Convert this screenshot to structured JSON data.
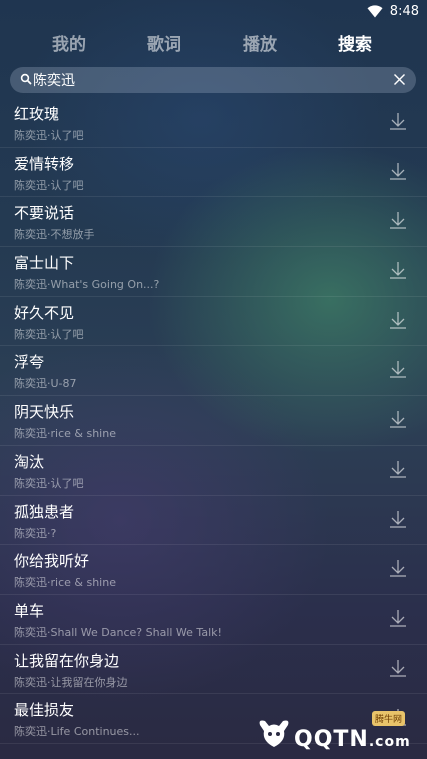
{
  "status": {
    "time": "8:48"
  },
  "tabs": [
    {
      "label": "我的"
    },
    {
      "label": "歌词"
    },
    {
      "label": "播放"
    },
    {
      "label": "搜索"
    }
  ],
  "search": {
    "value": "陈奕迅"
  },
  "songs": [
    {
      "title": "红玫瑰",
      "subtitle": "陈奕迅·认了吧"
    },
    {
      "title": "爱情转移",
      "subtitle": "陈奕迅·认了吧"
    },
    {
      "title": "不要说话",
      "subtitle": "陈奕迅·不想放手"
    },
    {
      "title": "富士山下",
      "subtitle": "陈奕迅·What's Going On...?"
    },
    {
      "title": "好久不见",
      "subtitle": "陈奕迅·认了吧"
    },
    {
      "title": "浮夸",
      "subtitle": "陈奕迅·U-87"
    },
    {
      "title": "阴天快乐",
      "subtitle": "陈奕迅·rice & shine"
    },
    {
      "title": "淘汰",
      "subtitle": "陈奕迅·认了吧"
    },
    {
      "title": "孤独患者",
      "subtitle": "陈奕迅·?"
    },
    {
      "title": "你给我听好",
      "subtitle": "陈奕迅·rice & shine"
    },
    {
      "title": "单车",
      "subtitle": "陈奕迅·Shall We Dance? Shall We Talk!"
    },
    {
      "title": "让我留在你身边",
      "subtitle": "陈奕迅·让我留在你身边"
    },
    {
      "title": "最佳损友",
      "subtitle": "陈奕迅·Life Continues..."
    }
  ],
  "watermark": {
    "text": "QQTN",
    "suffix": ".com",
    "badge": "腾牛网"
  }
}
